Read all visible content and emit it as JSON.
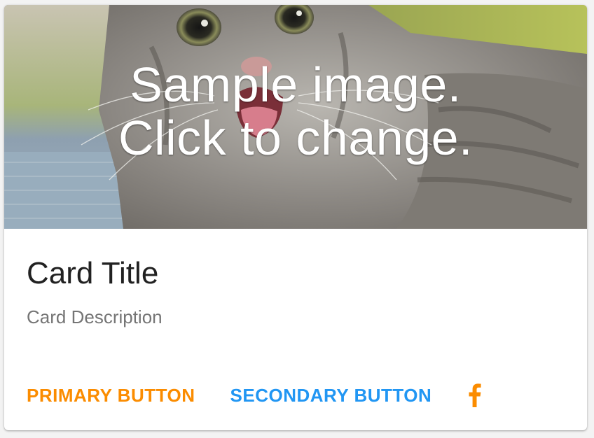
{
  "card": {
    "image_overlay_line1": "Sample image.",
    "image_overlay_line2": "Click to change.",
    "title": "Card Title",
    "description": "Card Description",
    "primary_button": "PRIMARY BUTTON",
    "secondary_button": "SECONDARY BUTTON",
    "social_icon": "facebook-icon"
  },
  "colors": {
    "primary": "#FB8C00",
    "secondary": "#2196F3",
    "title": "#212121",
    "description": "#757575"
  }
}
